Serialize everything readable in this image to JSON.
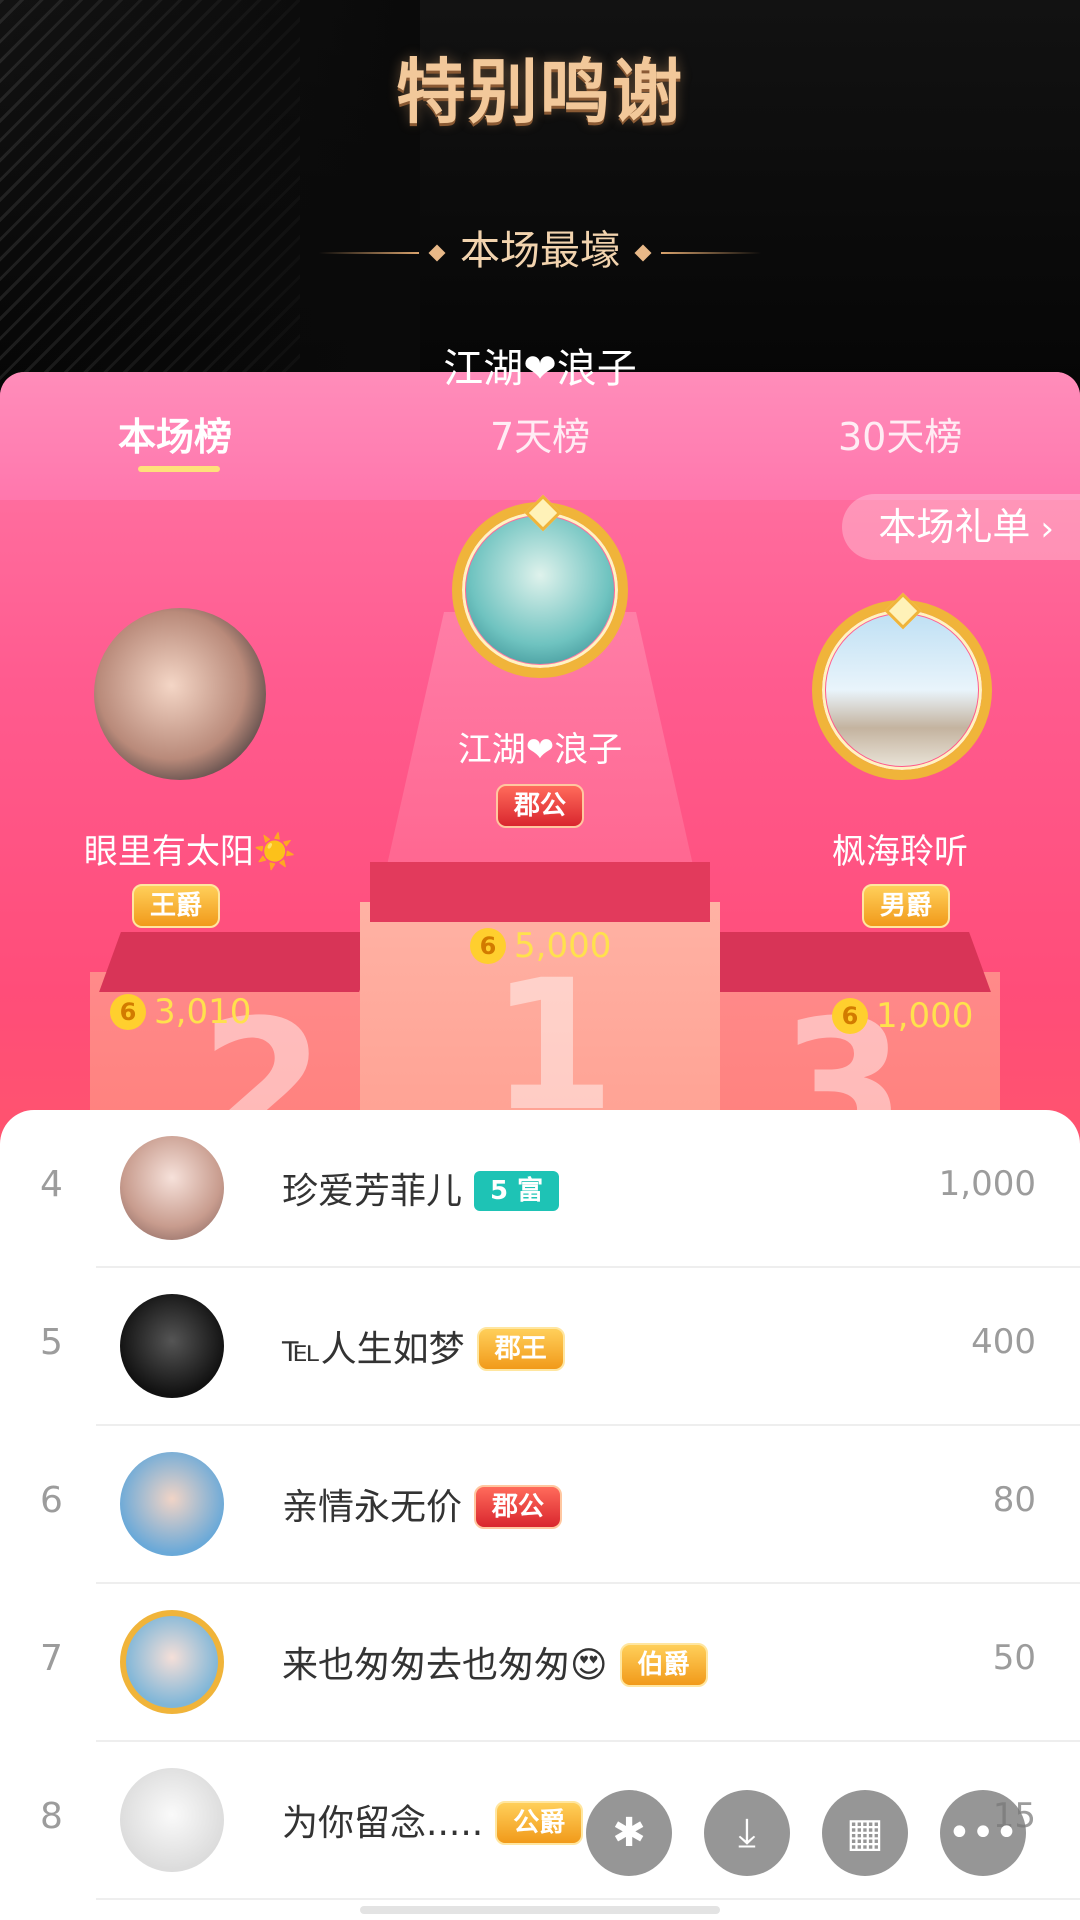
{
  "banner": {
    "title": "特别鸣谢",
    "subtitle": "本场最壕",
    "name": "江湖❤浪子"
  },
  "tabs": [
    {
      "label": "本场榜",
      "active": true
    },
    {
      "label": "7天榜",
      "active": false
    },
    {
      "label": "30天榜",
      "active": false
    }
  ],
  "gift_list_label": "本场礼单",
  "podium": {
    "first": {
      "name": "江湖❤浪子",
      "badge": "郡公",
      "amount": "5,000",
      "rank_number": "1"
    },
    "second": {
      "name": "眼里有太阳☀️",
      "badge": "王爵",
      "amount": "3,010",
      "rank_number": "2"
    },
    "third": {
      "name": "枫海聆听",
      "badge": "男爵",
      "amount": "1,000",
      "rank_number": "3"
    }
  },
  "coin_symbol": "6",
  "ranking": [
    {
      "rank": "4",
      "name": "珍爱芳菲儿",
      "badge": "5 富",
      "score": "1,000"
    },
    {
      "rank": "5",
      "name": "℡人生如梦",
      "badge": "郡王",
      "score": "400"
    },
    {
      "rank": "6",
      "name": "亲情永无价",
      "badge": "郡公",
      "score": "80"
    },
    {
      "rank": "7",
      "name": "来也匆匆去也匆匆😍",
      "badge": "伯爵",
      "score": "50"
    },
    {
      "rank": "8",
      "name": "为你留念.....",
      "badge": "公爵",
      "score": "15"
    }
  ],
  "fab_icons": [
    "share-icon",
    "save-icon",
    "grid-icon",
    "more-icon"
  ],
  "colors": {
    "gold": "#f2c89a",
    "pink": "#ff5b8f",
    "coin": "#ffcf2e",
    "teal_badge": "#1ec3b5"
  }
}
